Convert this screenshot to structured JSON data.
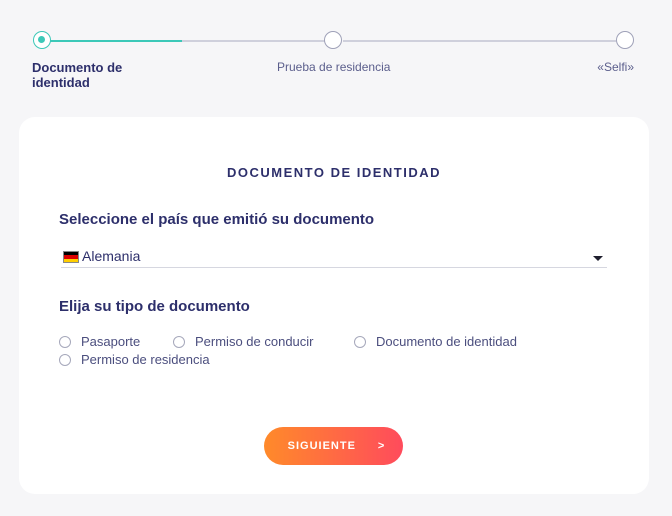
{
  "stepper": {
    "steps": [
      {
        "label": "Documento de identidad",
        "state": "active"
      },
      {
        "label": "Prueba de residencia",
        "state": "pending"
      },
      {
        "label": "«Selfi»",
        "state": "pending"
      }
    ],
    "accent": "#3cc8b8"
  },
  "card": {
    "title": "DOCUMENTO DE IDENTIDAD",
    "country_label": "Seleccione el país que emitió su documento",
    "country_select": {
      "value": "Alemania",
      "flag_icon": "germany-flag-icon",
      "flag_colors": [
        "#000000",
        "#dd0000",
        "#ffce00"
      ]
    },
    "doc_type_label": "Elija su tipo de documento",
    "doc_types": [
      {
        "label": "Pasaporte",
        "selected": false
      },
      {
        "label": "Permiso de conducir",
        "selected": false
      },
      {
        "label": "Documento de identidad",
        "selected": false
      },
      {
        "label": "Permiso de residencia",
        "selected": false
      }
    ],
    "next_button": {
      "label": "SIGUIENTE",
      "arrow": ">"
    }
  },
  "colors": {
    "primary_text": "#2d2f6b",
    "button_gradient": [
      "#ff8a2a",
      "#ff4b5c"
    ]
  }
}
